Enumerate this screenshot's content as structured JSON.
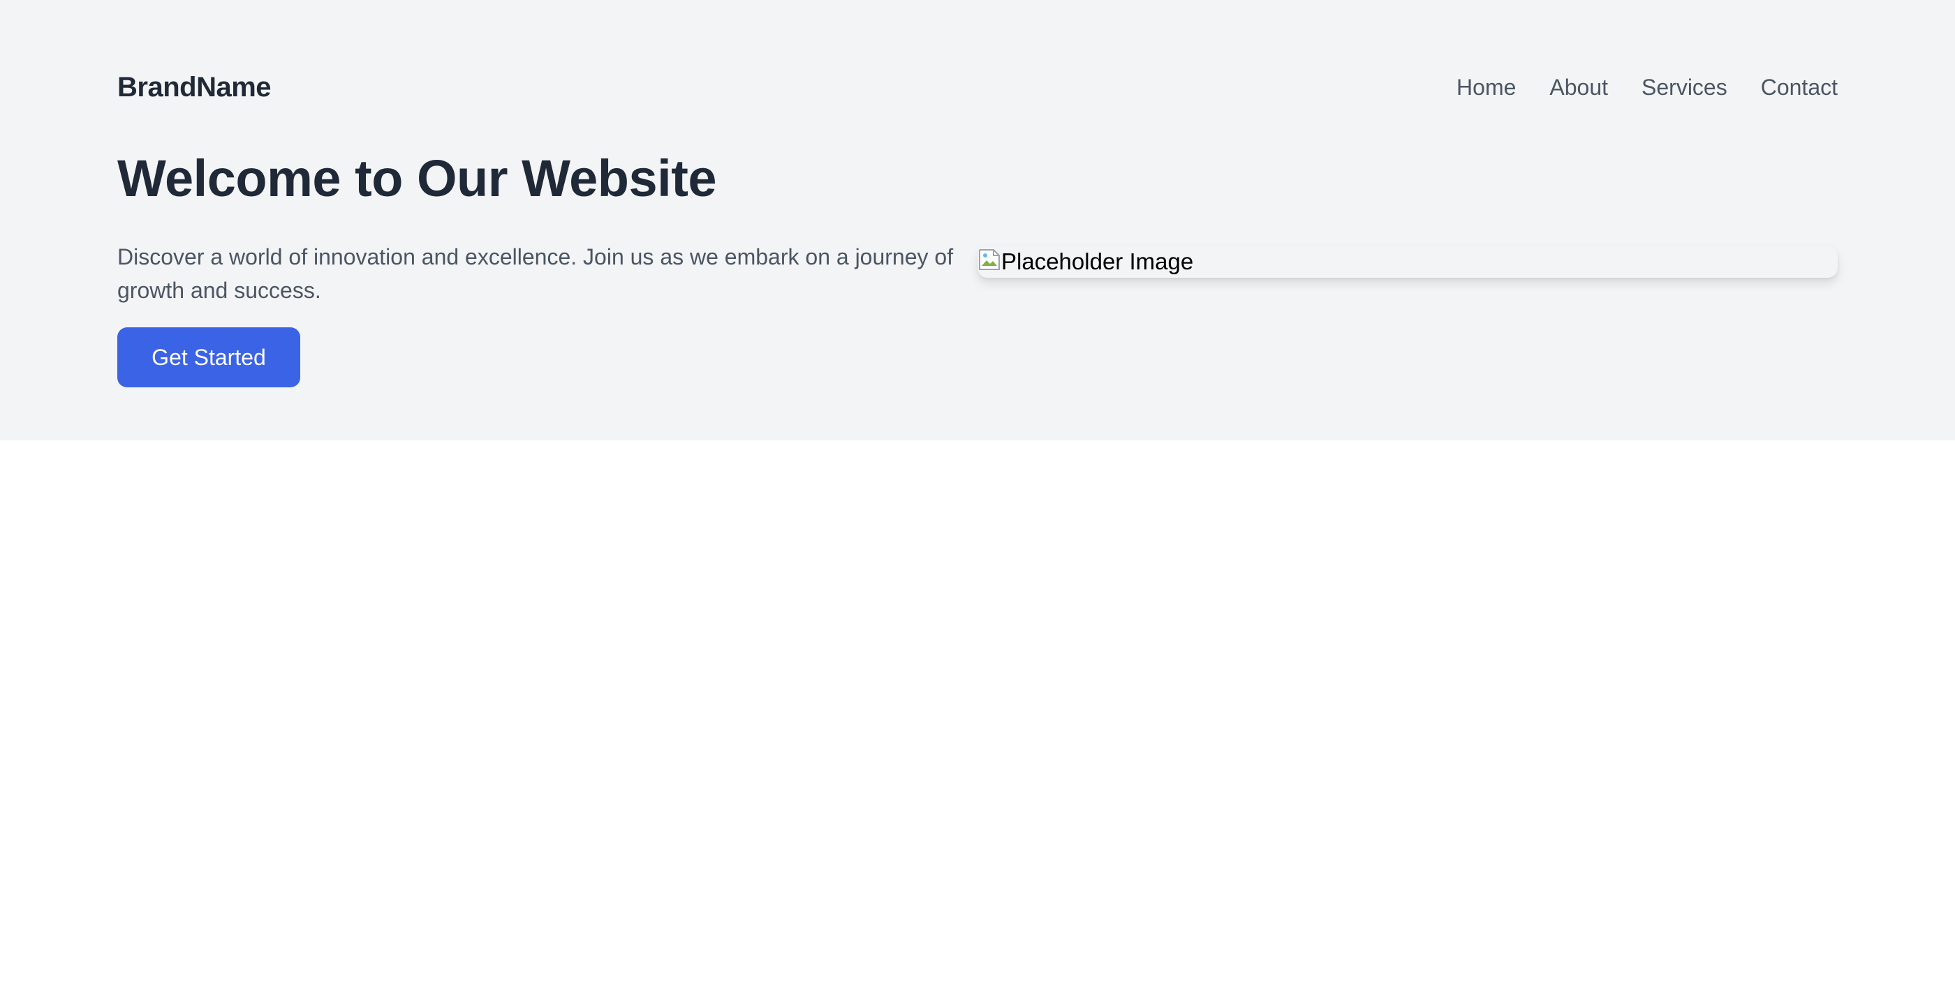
{
  "brand": "BrandName",
  "nav": {
    "items": [
      {
        "label": "Home"
      },
      {
        "label": "About"
      },
      {
        "label": "Services"
      },
      {
        "label": "Contact"
      }
    ]
  },
  "hero": {
    "title": "Welcome to Our Website",
    "description": "Discover a world of innovation and excellence. Join us as we embark on a journey of growth and success.",
    "cta_label": "Get Started",
    "image": {
      "alt": "Placeholder Image",
      "icon": "broken-image-icon"
    }
  },
  "colors": {
    "hero_background": "#f3f4f6",
    "heading": "#1f2937",
    "body_text": "#4b5563",
    "accent": "#3b63e6"
  }
}
